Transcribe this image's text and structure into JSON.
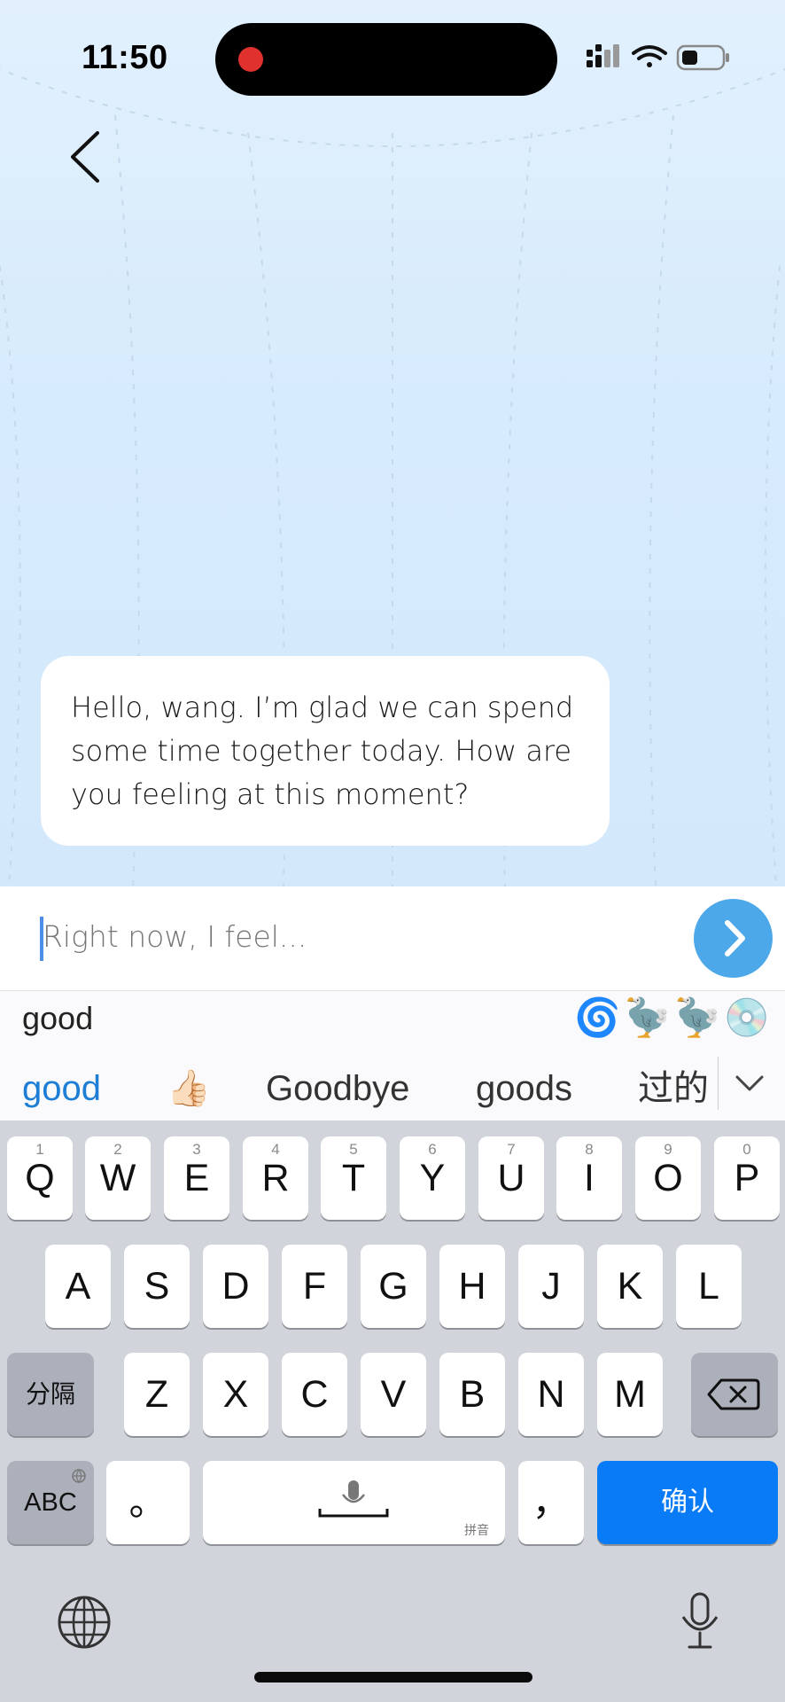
{
  "status_bar": {
    "time": "11:50"
  },
  "chat": {
    "messages": [
      {
        "text": "Hello, wang. I’m glad we can spend some time together today. How are you feeling at this moment?"
      }
    ]
  },
  "composer": {
    "placeholder": "Right now, I feel...",
    "value": ""
  },
  "ime": {
    "composing": "good",
    "emoji_suggestions": "🌀🦤🦤💿",
    "candidates": [
      "good",
      "👍🏻",
      "Goodbye",
      "goods",
      "过的"
    ]
  },
  "keyboard": {
    "row1": [
      {
        "label": "Q",
        "num": "1"
      },
      {
        "label": "W",
        "num": "2"
      },
      {
        "label": "E",
        "num": "3"
      },
      {
        "label": "R",
        "num": "4"
      },
      {
        "label": "T",
        "num": "5"
      },
      {
        "label": "Y",
        "num": "6"
      },
      {
        "label": "U",
        "num": "7"
      },
      {
        "label": "I",
        "num": "8"
      },
      {
        "label": "O",
        "num": "9"
      },
      {
        "label": "P",
        "num": "0"
      }
    ],
    "row2": [
      "A",
      "S",
      "D",
      "F",
      "G",
      "H",
      "J",
      "K",
      "L"
    ],
    "row3": [
      "Z",
      "X",
      "C",
      "V",
      "B",
      "N",
      "M"
    ],
    "separator_label": "分隔",
    "abc_label": "ABC",
    "period_label": "。",
    "comma_label": "，",
    "space_sub_label": "拼音",
    "confirm_label": "确认"
  },
  "colors": {
    "accent_blue": "#0a7bf7",
    "send_button": "#4da8ea",
    "record_dot": "#e0312f"
  },
  "icons": [
    "back-chevron-icon",
    "signal-icon",
    "wifi-icon",
    "battery-icon",
    "send-arrow-icon",
    "chevron-down-icon",
    "delete-icon",
    "microphone-icon",
    "globe-icon"
  ]
}
